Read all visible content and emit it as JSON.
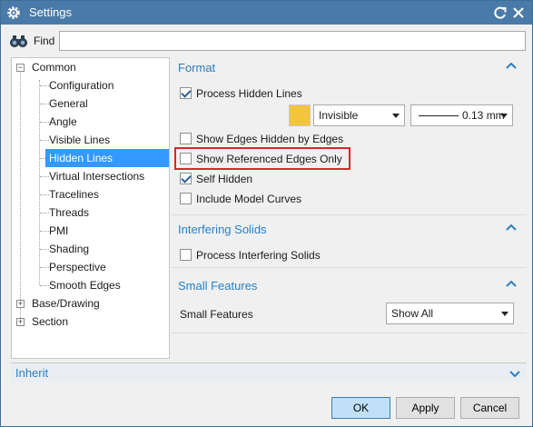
{
  "window": {
    "title": "Settings"
  },
  "find": {
    "label": "Find",
    "value": "",
    "placeholder": ""
  },
  "tree": {
    "items": [
      {
        "label": "Common",
        "level": 0,
        "expanded": true
      },
      {
        "label": "Configuration",
        "level": 1
      },
      {
        "label": "General",
        "level": 1
      },
      {
        "label": "Angle",
        "level": 1
      },
      {
        "label": "Visible Lines",
        "level": 1
      },
      {
        "label": "Hidden Lines",
        "level": 1,
        "selected": true
      },
      {
        "label": "Virtual Intersections",
        "level": 1
      },
      {
        "label": "Tracelines",
        "level": 1
      },
      {
        "label": "Threads",
        "level": 1
      },
      {
        "label": "PMI",
        "level": 1
      },
      {
        "label": "Shading",
        "level": 1
      },
      {
        "label": "Perspective",
        "level": 1
      },
      {
        "label": "Smooth Edges",
        "level": 1
      },
      {
        "label": "Base/Drawing",
        "level": 0,
        "expanded": false
      },
      {
        "label": "Section",
        "level": 0,
        "expanded": false
      }
    ]
  },
  "format": {
    "title": "Format",
    "process_hidden_lines": {
      "label": "Process Hidden Lines",
      "checked": true
    },
    "color": "#f4c43a",
    "font_select": {
      "value": "Invisible"
    },
    "width_select": {
      "value": "0.13 mm"
    },
    "show_edges_hidden": {
      "label": "Show Edges Hidden by Edges",
      "checked": false
    },
    "show_referenced_edges": {
      "label": "Show Referenced Edges Only",
      "checked": false
    },
    "self_hidden": {
      "label": "Self Hidden",
      "checked": true
    },
    "include_model_curves": {
      "label": "Include Model Curves",
      "checked": false
    }
  },
  "interfering": {
    "title": "Interfering Solids",
    "process_interfering": {
      "label": "Process Interfering Solids",
      "checked": false
    }
  },
  "small_features": {
    "title": "Small Features",
    "label": "Small Features",
    "select": {
      "value": "Show All"
    }
  },
  "inherit": {
    "title": "Inherit"
  },
  "buttons": {
    "ok": "OK",
    "apply": "Apply",
    "cancel": "Cancel"
  },
  "colors": {
    "accent": "#2a7fc1",
    "titlebar": "#4a7ba8",
    "selection": "#3399ff",
    "highlight": "#d9262c"
  },
  "icons": {
    "app": "gear-icon",
    "refresh": "refresh-icon",
    "close": "close-icon",
    "find": "binoculars-icon",
    "collapse": "chevron-up-icon",
    "expand": "chevron-down-icon"
  }
}
